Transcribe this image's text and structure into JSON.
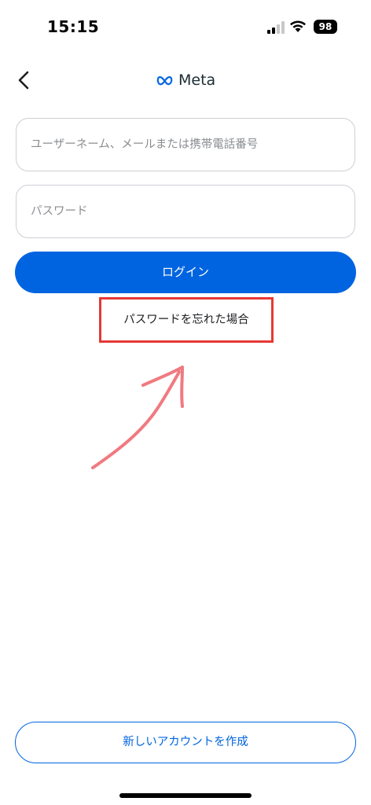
{
  "status_bar": {
    "time": "15:15",
    "battery": "98"
  },
  "header": {
    "logo_text": "Meta",
    "logo_icon": "meta-infinity-icon",
    "back_icon": "chevron-left-icon"
  },
  "form": {
    "username_placeholder": "ユーザーネーム、メールまたは携帯電話番号",
    "username_value": "",
    "password_placeholder": "パスワード",
    "password_value": "",
    "login_label": "ログイン",
    "forgot_label": "パスワードを忘れた場合"
  },
  "footer": {
    "create_account_label": "新しいアカウントを作成"
  },
  "colors": {
    "accent": "#0064e0",
    "annotation": "#e53935",
    "arrow": "#f07a80"
  }
}
